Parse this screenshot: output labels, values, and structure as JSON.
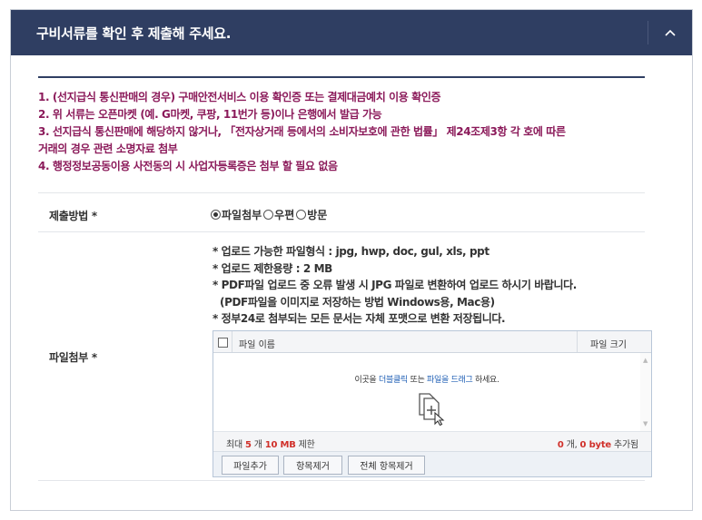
{
  "header": {
    "title": "구비서류를 확인 후 제출해 주세요.",
    "collapse_icon": "chevron-up-icon"
  },
  "notes": [
    "1. (선지급식 통신판매의 경우) 구매안전서비스 이용 확인증 또는 결제대금예치 이용 확인증",
    "2. 위 서류는 오픈마켓 (예. G마켓, 쿠팡, 11번가 등)이나 은행에서 발급 가능",
    "3. 선지급식 통신판매에 해당하지 않거나, 「전자상거래 등에서의 소비자보호에 관한 법률」 제24조제3항 각 호에 따른",
    "거래의 경우 관련 소명자료 첨부",
    "4. 행정정보공동이용 사전동의 시 사업자등록증은 첨부 할 필요 없음"
  ],
  "submission": {
    "label": "제출방법 *",
    "options": [
      "파일첨부",
      "우편",
      "방문"
    ],
    "selected": "파일첨부"
  },
  "attachment": {
    "label": "파일첨부 *",
    "guide": [
      "* 업로드 가능한 파일형식 : jpg, hwp, doc, gul, xls, ppt",
      "* 업로드 제한용량 : 2 MB",
      "* PDF파일 업로드 중 오류 발생 시 JPG 파일로 변환하여 업로드 하시기 바랍니다.",
      "(PDF파일을 이미지로 저장하는 방법  Windows용, Mac용)",
      "* 정부24로 첨부되는 모든 문서는 자체 포맷으로 변환 저장됩니다."
    ]
  },
  "uploader": {
    "col_name": "파일 이름",
    "col_size": "파일 크기",
    "drop_prefix": "이곳을 ",
    "drop_link1": "더블클릭",
    "drop_mid": " 또는 ",
    "drop_link2": "파일을 드래그",
    "drop_suffix": " 하세요.",
    "limit_prefix": "최대 ",
    "limit_count": "5",
    "limit_mid": " 개 ",
    "limit_size": "10 MB",
    "limit_suffix": " 제한",
    "added_count": "0",
    "added_mid": " 개, ",
    "added_size": "0 byte",
    "added_suffix": " 추가됨",
    "buttons": {
      "add": "파일추가",
      "remove": "항목제거",
      "remove_all": "전체 항목제거"
    }
  },
  "colors": {
    "header_bg": "#2f3e62",
    "note_text": "#8b1a5a",
    "link_blue": "#1f5fb5",
    "count_red": "#d0302a"
  }
}
